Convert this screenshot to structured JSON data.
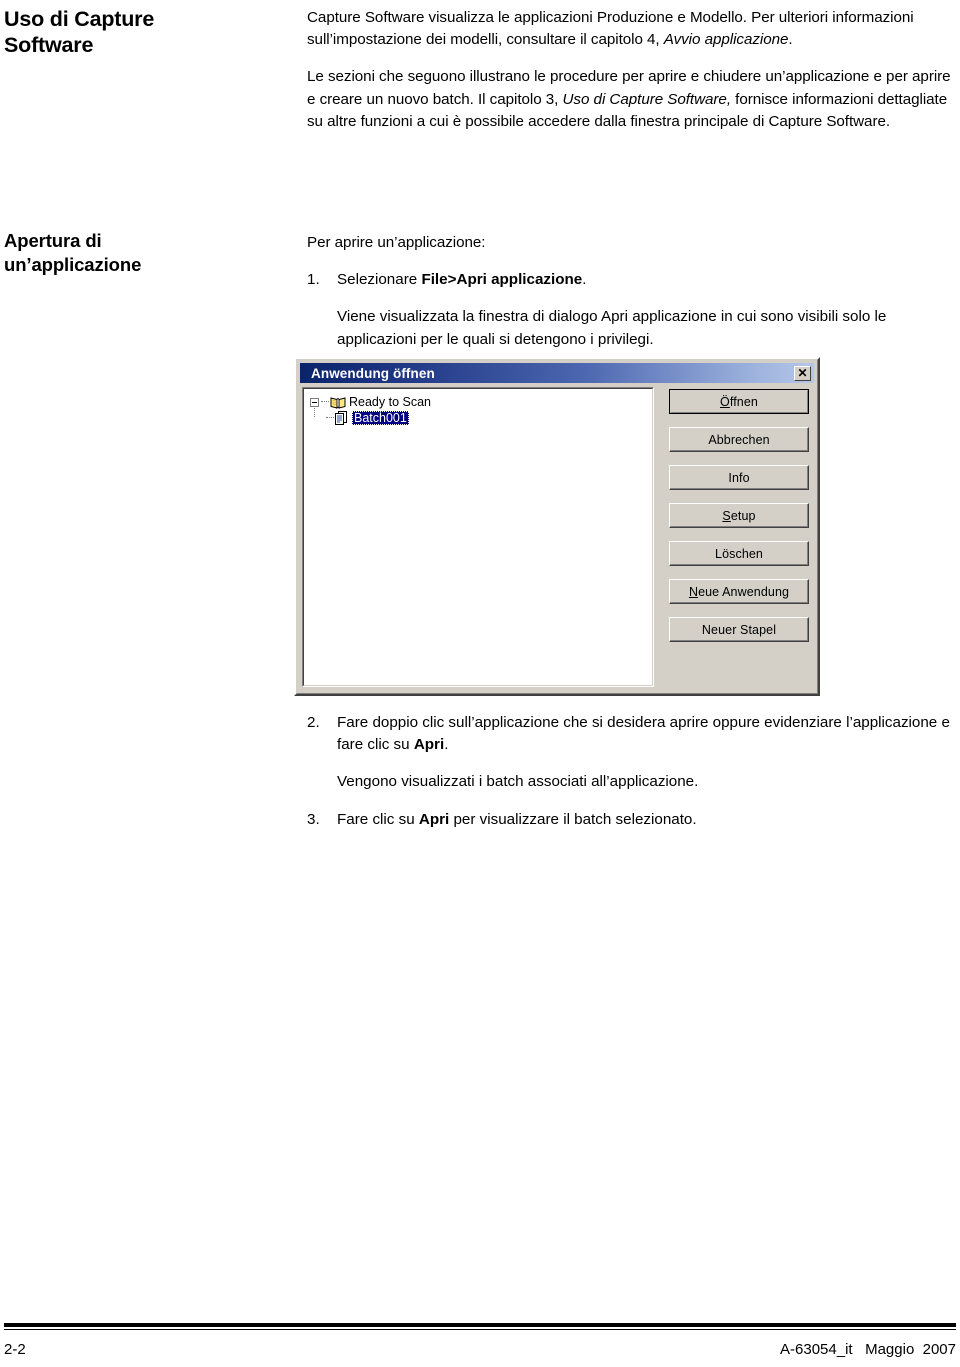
{
  "document": {
    "language": "it",
    "section_heading": "Uso di Capture Software",
    "subsection_heading": "Apertura di un’applicazione"
  },
  "headings": {
    "main_line1": "Uso di Capture",
    "main_line2": "Software",
    "sub_line1": "Apertura di",
    "sub_line2": "un’applicazione"
  },
  "intro": {
    "p1_a": "Capture Software visualizza le applicazioni Produzione e Modello. Per ulteriori informazioni sull’impostazione dei modelli, consultare il capitolo 4, ",
    "p1_italic": "Avvio applicazione",
    "p1_b": ".",
    "p2_a": "Le sezioni che seguono illustrano le procedure per aprire e chiudere un’applicazione e per aprire e creare un nuovo batch. Il capitolo 3, ",
    "p2_italic": "Uso di Capture Software,",
    "p2_b": " fornisce informazioni dettagliate su altre funzioni  a cui è possibile accedere dalla finestra principale di Capture Software."
  },
  "procedure": {
    "lead_in": "Per aprire un’applicazione:",
    "step1": {
      "number": "1.",
      "text_a": "Selezionare ",
      "text_bold": "File>Apri applicazione",
      "text_b": "."
    },
    "step1_note": "Viene visualizzata la finestra di dialogo Apri applicazione in cui sono visibili solo le applicazioni per le quali si detengono i privilegi.",
    "step2": {
      "number": "2.",
      "text_a": "Fare doppio clic sull’applicazione che si desidera aprire oppure evidenziare l’applicazione e fare clic su ",
      "text_bold": "Apri",
      "text_b": "."
    },
    "step2_note": "Vengono visualizzati i batch associati all’applicazione.",
    "step3": {
      "number": "3.",
      "text_a": "Fare clic su ",
      "text_bold": "Apri",
      "text_b": " per visualizzare il batch selezionato."
    }
  },
  "dialog": {
    "title": "Anwendung öffnen",
    "close_label": "✕",
    "tree": {
      "root": {
        "label": "Ready to Scan",
        "expanded": true,
        "icon": "open-book-icon"
      },
      "child": {
        "label": "Batch001",
        "selected": true,
        "icon": "document-icon"
      }
    },
    "buttons": [
      {
        "label_pre": "",
        "mnemonic": "Ö",
        "label_post": "ffnen",
        "name": "open-button",
        "default": true
      },
      {
        "label_pre": "Abbrechen",
        "mnemonic": "",
        "label_post": "",
        "name": "cancel-button",
        "default": false
      },
      {
        "label_pre": "Info",
        "mnemonic": "",
        "label_post": "",
        "name": "info-button",
        "default": false
      },
      {
        "label_pre": "",
        "mnemonic": "S",
        "label_post": "etup",
        "name": "setup-button",
        "default": false
      },
      {
        "label_pre": "Löschen",
        "mnemonic": "",
        "label_post": "",
        "name": "delete-button",
        "default": false
      },
      {
        "label_pre": "",
        "mnemonic": "N",
        "label_post": "eue Anwendung",
        "name": "new-application-button",
        "default": false
      },
      {
        "label_pre": "Neuer Stapel",
        "mnemonic": "",
        "label_post": "",
        "name": "new-batch-button",
        "default": false
      }
    ],
    "colors": {
      "face": "#d4d0c8",
      "title_gradient_start": "#0a246a",
      "title_gradient_end": "#b6c6e8",
      "selection": "#000080",
      "pane": "#ffffff"
    }
  },
  "footer": {
    "page_number": "2-2",
    "doc_code": "A-63054_it   Maggio  2007"
  }
}
